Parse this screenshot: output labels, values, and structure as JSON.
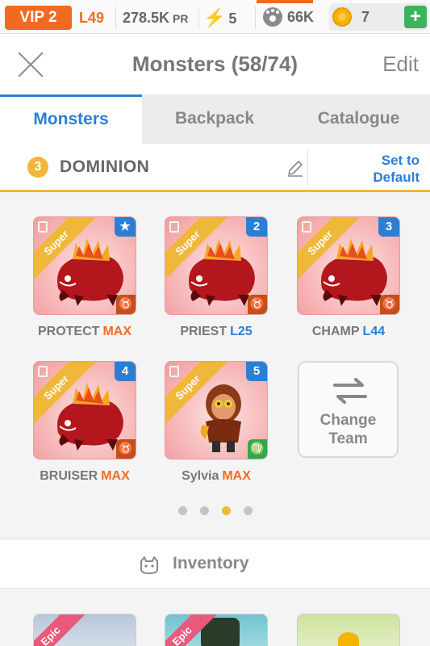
{
  "status_bar": {
    "vip": "VIP 2",
    "level": "L49",
    "power": "278.5K",
    "power_unit": "PR",
    "energy": "5",
    "bp": "66K",
    "gold": "7",
    "add_button": "+"
  },
  "nav": {
    "title": "Monsters (58/74)",
    "edit": "Edit"
  },
  "tabs": [
    {
      "label": "Monsters",
      "active": true
    },
    {
      "label": "Backpack",
      "active": false
    },
    {
      "label": "Catalogue",
      "active": false
    }
  ],
  "team": {
    "number": "3",
    "name": "DOMINION",
    "set_default_line1": "Set to",
    "set_default_line2": "Default"
  },
  "monsters": [
    {
      "name": "PROTECT",
      "level": "MAX",
      "level_color": "#f26a21",
      "rarity": "Super",
      "badge": "★",
      "element": "♉",
      "element_color": "#c2501a"
    },
    {
      "name": "PRIEST",
      "level": "L25",
      "level_color": "#2a7fd4",
      "rarity": "Super",
      "badge": "2",
      "element": "♉",
      "element_color": "#c2501a"
    },
    {
      "name": "CHAMP",
      "level": "L44",
      "level_color": "#2a7fd4",
      "rarity": "Super",
      "badge": "3",
      "element": "♉",
      "element_color": "#c2501a"
    },
    {
      "name": "BRUISER",
      "level": "MAX",
      "level_color": "#f26a21",
      "rarity": "Super",
      "badge": "4",
      "element": "♉",
      "element_color": "#c2501a"
    },
    {
      "name": "Sylvia",
      "level": "MAX",
      "level_color": "#f26a21",
      "rarity": "Super",
      "badge": "5",
      "element": "♍",
      "element_color": "#2fa84f"
    }
  ],
  "change_team": {
    "line1": "Change",
    "line2": "Team"
  },
  "pager": {
    "total": 4,
    "active_index": 2
  },
  "inventory": {
    "title": "Inventory",
    "items": [
      {
        "rarity": "Epic"
      },
      {
        "rarity": "Epic"
      },
      {
        "rarity": ""
      }
    ]
  },
  "colors": {
    "accent_blue": "#2a7fd4",
    "accent_orange": "#f26a21",
    "team_yellow": "#f0b83a",
    "gold_coin": "#f5b400",
    "add_green": "#3db35c"
  }
}
